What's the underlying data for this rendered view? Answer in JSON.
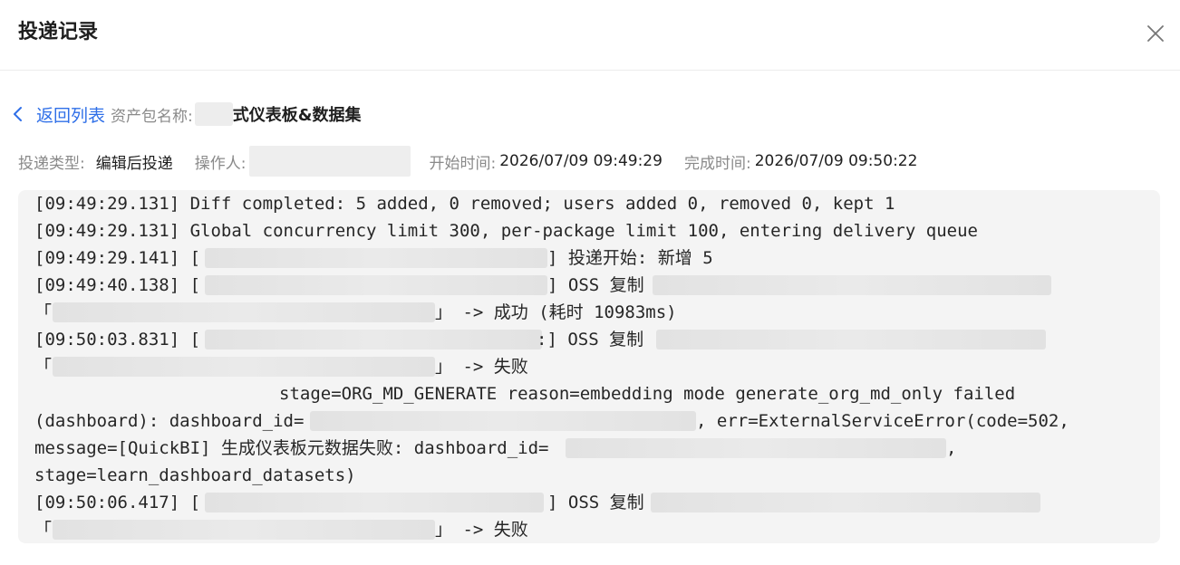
{
  "dialog": {
    "title": "投递记录"
  },
  "nav": {
    "back_label": "返回列表",
    "package_label": "资产包名称:",
    "package_value": "式仪表板&数据集"
  },
  "meta": {
    "type_label": "投递类型:",
    "type_value": "编辑后投递",
    "operator_label": "操作人:",
    "start_label": "开始时间:",
    "start_value": "2026/07/09 09:49:29",
    "end_label": "完成时间:",
    "end_value": "2026/07/09 09:50:22"
  },
  "log": {
    "l1": "[09:49:29.131] Diff completed: 5 added, 0 removed; users added 0, removed 0, kept 1",
    "l2": "[09:49:29.131] Global concurrency limit 300, per-package limit 100, entering delivery queue",
    "l3a": "[09:49:29.141] [",
    "l3b": "] 投递开始: 新增 5",
    "l4a": "[09:49:40.138] [",
    "l4b": "] OSS 复制",
    "l5a": "「",
    "l5b": "」 -> 成功 (耗时 10983ms)",
    "l6a": "[09:50:03.831] [",
    "l6b": ":] OSS 复制",
    "l7a": "「",
    "l7b": "」 -> 失败",
    "l8": "stage=ORG_MD_GENERATE reason=embedding mode generate_org_md_only failed",
    "l9a": "(dashboard): dashboard_id=",
    "l9b": ", err=ExternalServiceError(code=502,",
    "l10a": "message=[QuickBI] 生成仪表板元数据失败: dashboard_id=",
    "l10b": ",",
    "l11": "stage=learn_dashboard_datasets)",
    "l12a": "[09:50:06.417] [",
    "l12b": "] OSS 复制",
    "l13a": "「",
    "l13b": "」 -> 失败"
  }
}
